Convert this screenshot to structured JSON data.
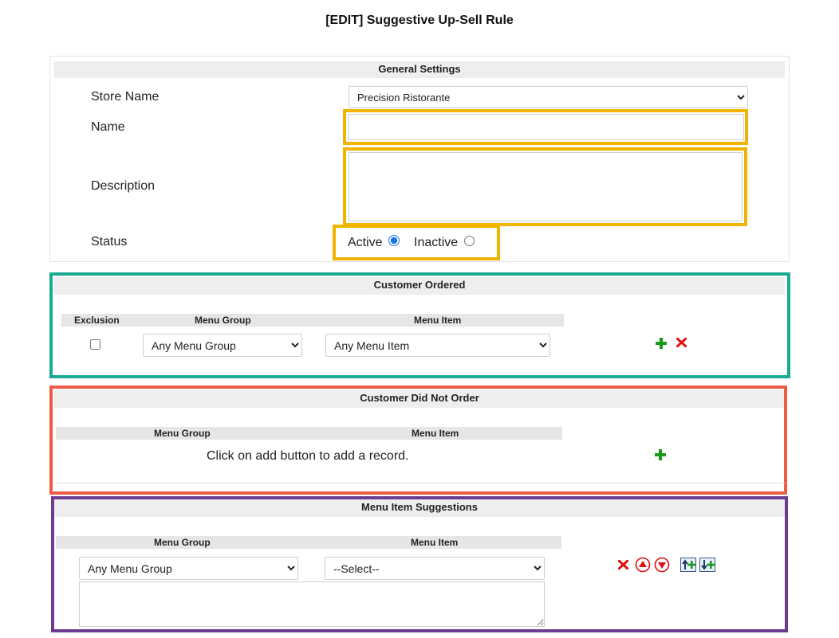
{
  "page": {
    "title": "[EDIT] Suggestive Up-Sell Rule"
  },
  "general": {
    "header": "General Settings",
    "store_name_label": "Store Name",
    "store_name_value": "Precision Ristorante",
    "name_label": "Name",
    "name_value": "",
    "description_label": "Description",
    "description_value": "",
    "status_label": "Status",
    "active_label": "Active",
    "inactive_label": "Inactive",
    "status_selected": "Active"
  },
  "customer_ordered": {
    "header": "Customer Ordered",
    "col_exclusion": "Exclusion",
    "col_menu_group": "Menu Group",
    "col_menu_item": "Menu Item",
    "row": {
      "exclusion": false,
      "menu_group": "Any Menu Group",
      "menu_item": "Any Menu Item"
    }
  },
  "customer_did_not_order": {
    "header": "Customer Did Not Order",
    "col_menu_group": "Menu Group",
    "col_menu_item": "Menu Item",
    "empty_message": "Click on add button to add a record."
  },
  "menu_item_suggestions": {
    "header": "Menu Item Suggestions",
    "col_menu_group": "Menu Group",
    "col_menu_item": "Menu Item",
    "row": {
      "menu_group": "Any Menu Group",
      "menu_item": "--Select--"
    }
  },
  "colors": {
    "highlight_yellow": "#f0b400",
    "highlight_teal": "#1aab92",
    "highlight_coral": "#ef5c44",
    "highlight_purple": "#6b3c91",
    "add_green": "#1a9a1a",
    "delete_red": "#e01010"
  }
}
